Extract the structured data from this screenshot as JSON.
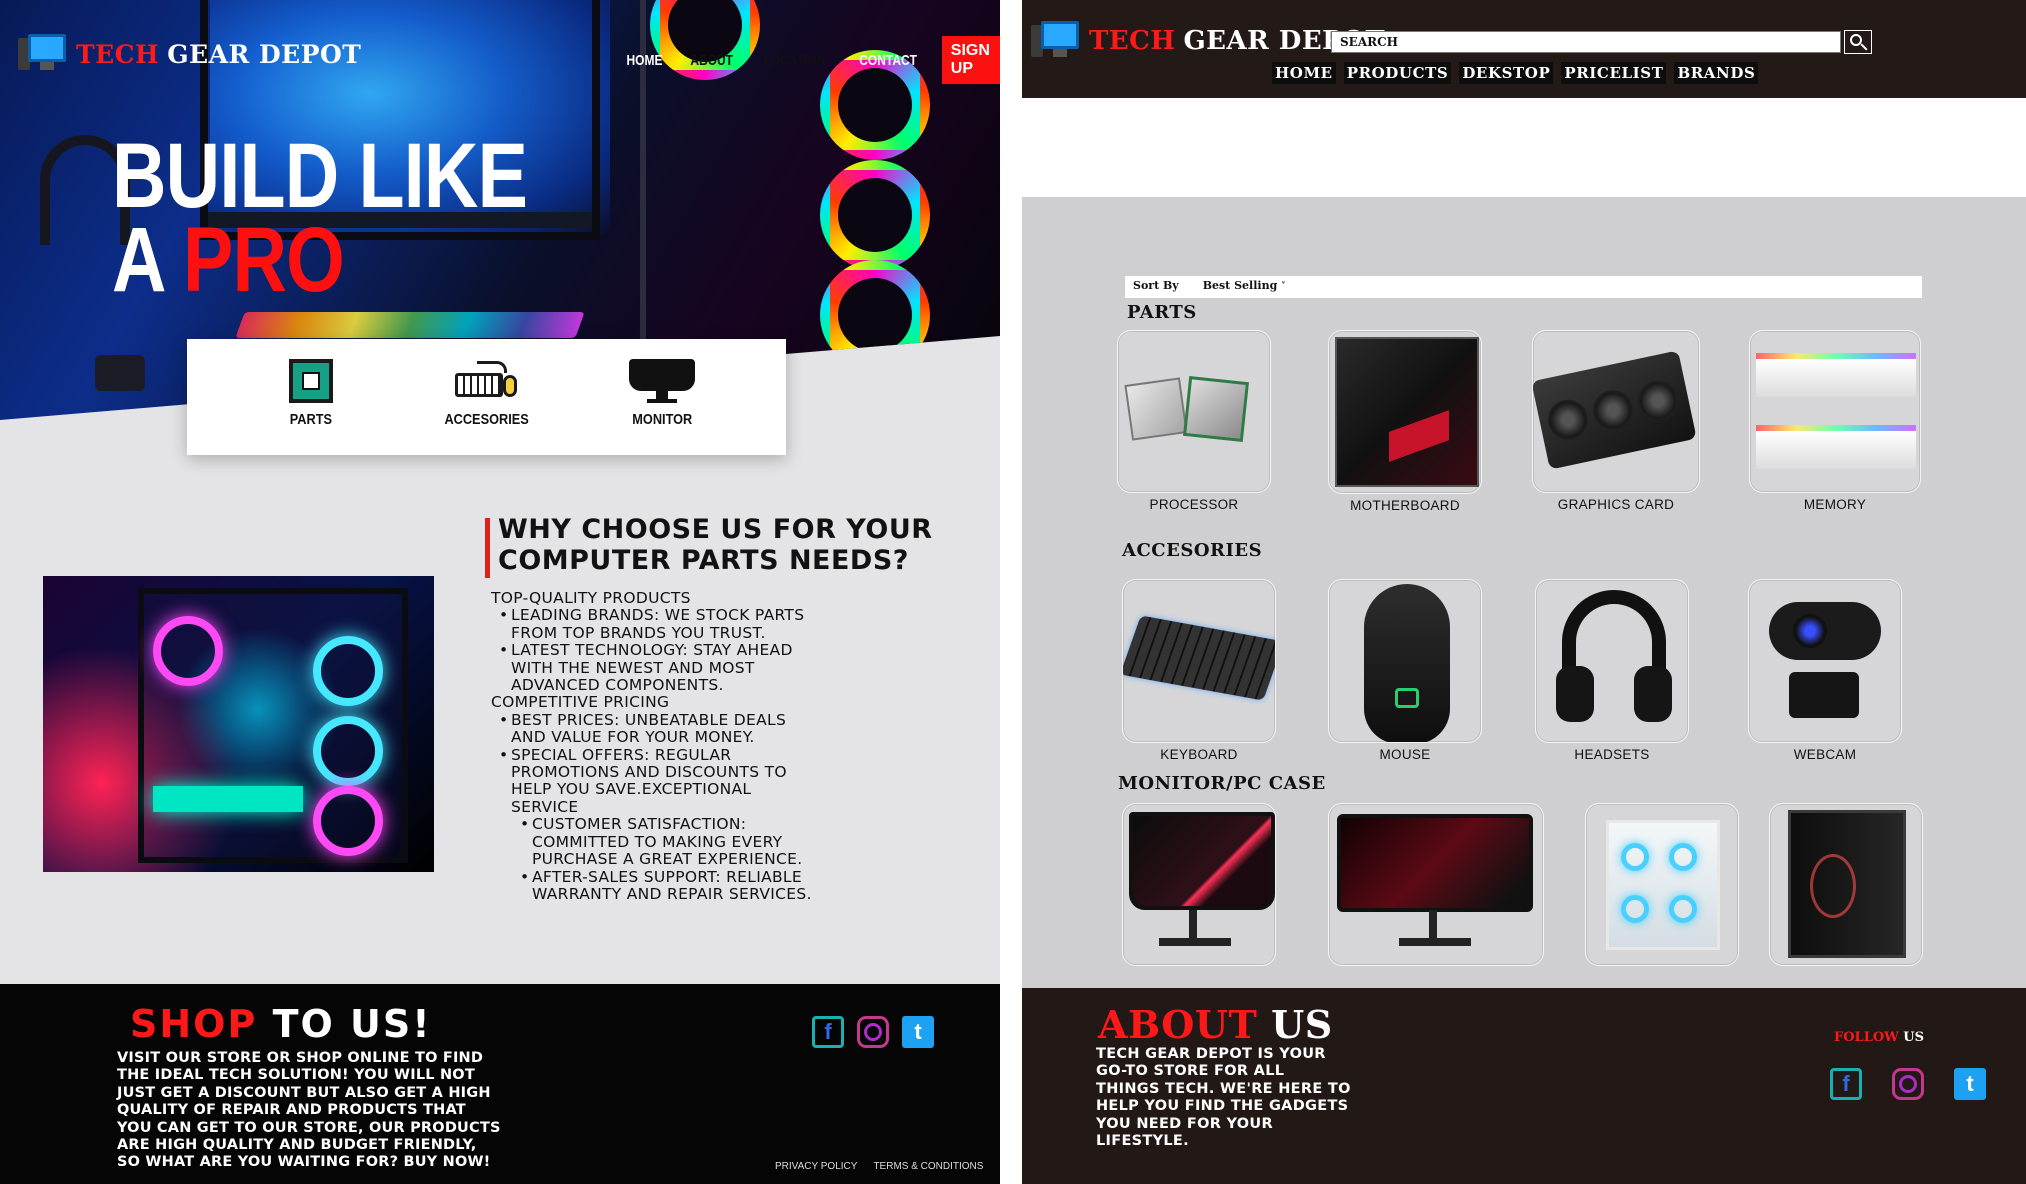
{
  "left_page": {
    "brand": {
      "part1": "TECH",
      "part2": "GEAR DEPOT"
    },
    "nav": [
      "HOME",
      "ABOUT",
      "LOCATION",
      "CONTACT"
    ],
    "signup": "SIGN UP",
    "hero": {
      "line1": "BUILD LIKE",
      "line2_prefix": "A",
      "line2_accent": "PRO"
    },
    "categories": [
      "PARTS",
      "ACCESORIES",
      "MONITOR"
    ],
    "why_title": [
      "WHY CHOOSE US FOR YOUR",
      "COMPUTER PARTS NEEDS?"
    ],
    "why_lines": [
      {
        "level": "sec",
        "text": "TOP-QUALITY PRODUCTS"
      },
      {
        "level": "b1",
        "text": "LEADING BRANDS: WE STOCK PARTS"
      },
      {
        "level": "cont1",
        "text": "FROM TOP BRANDS YOU TRUST."
      },
      {
        "level": "b1",
        "text": "LATEST TECHNOLOGY: STAY AHEAD"
      },
      {
        "level": "cont1",
        "text": "WITH THE NEWEST AND MOST"
      },
      {
        "level": "cont1",
        "text": "ADVANCED COMPONENTS."
      },
      {
        "level": "sec",
        "text": "COMPETITIVE PRICING"
      },
      {
        "level": "b1",
        "text": "BEST PRICES: UNBEATABLE DEALS"
      },
      {
        "level": "cont1",
        "text": "AND VALUE FOR YOUR MONEY."
      },
      {
        "level": "b1",
        "text": "SPECIAL OFFERS: REGULAR"
      },
      {
        "level": "cont1",
        "text": "PROMOTIONS AND DISCOUNTS TO"
      },
      {
        "level": "cont1",
        "text": "HELP YOU SAVE.EXCEPTIONAL"
      },
      {
        "level": "cont1",
        "text": "SERVICE"
      },
      {
        "level": "b2",
        "text": "CUSTOMER SATISFACTION:"
      },
      {
        "level": "cont2",
        "text": "COMMITTED TO MAKING EVERY"
      },
      {
        "level": "cont2",
        "text": "PURCHASE A GREAT EXPERIENCE."
      },
      {
        "level": "b2",
        "text": "AFTER-SALES SUPPORT: RELIABLE"
      },
      {
        "level": "cont2",
        "text": "WARRANTY AND REPAIR SERVICES."
      }
    ],
    "footer": {
      "title_accent": "SHOP",
      "title_rest": "TO US!",
      "text_lines": [
        "VISIT OUR STORE OR SHOP ONLINE TO FIND",
        "THE IDEAL TECH SOLUTION! YOU WILL NOT",
        "JUST GET A DISCOUNT BUT ALSO GET A HIGH",
        "QUALITY OF REPAIR AND PRODUCTS THAT",
        "YOU CAN GET TO OUR STORE, OUR PRODUCTS",
        "ARE HIGH QUALITY AND BUDGET FRIENDLY,",
        "SO WHAT ARE YOU WAITING FOR? BUY NOW!"
      ],
      "privacy": "PRIVACY POLICY",
      "terms": "TERMS & CONDITIONS"
    },
    "social_icons": [
      "facebook-icon",
      "instagram-icon",
      "twitter-icon"
    ]
  },
  "right_page": {
    "brand": {
      "part1": "TECH",
      "part2": "GEAR DEPOT"
    },
    "search_placeholder": "SEARCH",
    "nav": [
      "HOME",
      "PRODUCTS",
      "DEKSTOP",
      "PRICELIST",
      "BRANDS"
    ],
    "sort": {
      "label": "Sort By",
      "value": "Best Selling",
      "caret": "˅"
    },
    "sections": {
      "parts": "PARTS",
      "accessories": "ACCESORIES",
      "monitors": "MONITOR/PC CASE"
    },
    "parts": [
      "PROCESSOR",
      "MOTHERBOARD",
      "GRAPHICS CARD",
      "MEMORY"
    ],
    "accessories": [
      "KEYBOARD",
      "MOUSE",
      "HEADSETS",
      "WEBCAM"
    ],
    "footer": {
      "title_accent": "ABOUT",
      "title_rest": "US",
      "text_lines": [
        "TECH GEAR DEPOT IS YOUR",
        "GO-TO STORE FOR ALL",
        "THINGS TECH. WE'RE HERE TO",
        "HELP YOU FIND THE GADGETS",
        "YOU NEED FOR YOUR",
        "LIFESTYLE."
      ],
      "follow_accent": "FOLLOW",
      "follow_rest": "US"
    },
    "colors": {
      "accent_red": "#ff1818",
      "header_bg": "#231a18",
      "page_bg": "#cfcfd1"
    }
  }
}
